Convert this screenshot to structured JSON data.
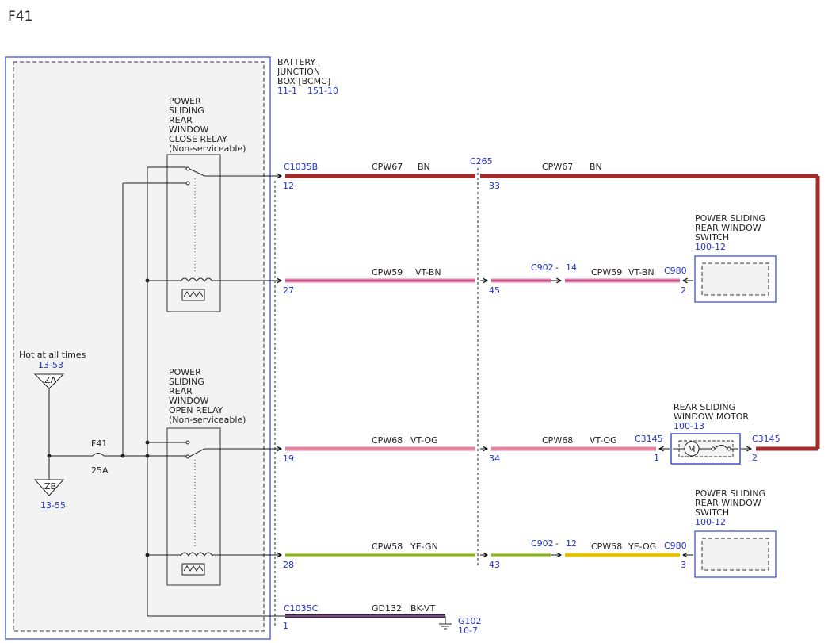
{
  "page_title": "F41",
  "bjb": {
    "l1": "BATTERY",
    "l2": "JUNCTION",
    "l3": "BOX [BCMC]",
    "ref1": "11-1",
    "ref2": "151-10"
  },
  "close_relay": {
    "l1": "POWER",
    "l2": "SLIDING",
    "l3": "REAR",
    "l4": "WINDOW",
    "l5": "CLOSE RELAY",
    "l6": "(Non-serviceable)"
  },
  "open_relay": {
    "l1": "POWER",
    "l2": "SLIDING",
    "l3": "REAR",
    "l4": "WINDOW",
    "l5": "OPEN RELAY",
    "l6": "(Non-serviceable)"
  },
  "hot": {
    "label": "Hot at all times",
    "ref": "13-53",
    "za": "ZA",
    "zb": "ZB",
    "zb_ref": "13-55"
  },
  "fuse": {
    "name": "F41",
    "rating": "25A"
  },
  "w1": {
    "conn": "C1035B",
    "pin": "12",
    "circuit": "CPW67",
    "color": "BN",
    "inline_conn": "C265",
    "inline_pin": "33",
    "circuit2": "CPW67",
    "color2": "BN"
  },
  "w2": {
    "pin": "27",
    "circuit": "CPW59",
    "color": "VT-BN",
    "inline_pin": "45",
    "conn2": "C902",
    "dash": "-",
    "pin2": "14",
    "circuit2": "CPW59",
    "color2": "VT-BN",
    "end_conn": "C980",
    "end_pin": "2"
  },
  "sw1": {
    "l1": "POWER SLIDING",
    "l2": "REAR WINDOW",
    "l3": "SWITCH",
    "ref": "100-12"
  },
  "motor": {
    "l1": "REAR SLIDING",
    "l2": "WINDOW MOTOR",
    "ref": "100-13",
    "symbol": "M",
    "conn_left": "C3145",
    "pin_left": "1",
    "conn_right": "C3145",
    "pin_right": "2"
  },
  "w3": {
    "pin": "19",
    "circuit": "CPW68",
    "color": "VT-OG",
    "inline_pin": "34",
    "circuit2": "CPW68",
    "color2": "VT-OG"
  },
  "w4": {
    "pin": "28",
    "circuit": "CPW58",
    "color": "YE-GN",
    "inline_pin": "43",
    "conn2": "C902",
    "dash": "-",
    "pin2": "12",
    "circuit2": "CPW58",
    "color2": "YE-OG",
    "end_conn": "C980",
    "end_pin": "3"
  },
  "sw2": {
    "l1": "POWER SLIDING",
    "l2": "REAR WINDOW",
    "l3": "SWITCH",
    "ref": "100-12"
  },
  "w5": {
    "conn": "C1035C",
    "pin": "1",
    "circuit": "GD132",
    "color": "BK-VT",
    "ground": "G102",
    "ground_ref": "10-7"
  },
  "colors": {
    "bn": "#a52a2a",
    "vt_bn": "#e07fb8",
    "vt_og": "#e07fb8",
    "ye_gn": "#c8d65a",
    "ye_og": "#e6d400",
    "bk_vt": "#3a1f3a",
    "ref_blue": "#2233cc",
    "box_blue": "#3344cc"
  }
}
